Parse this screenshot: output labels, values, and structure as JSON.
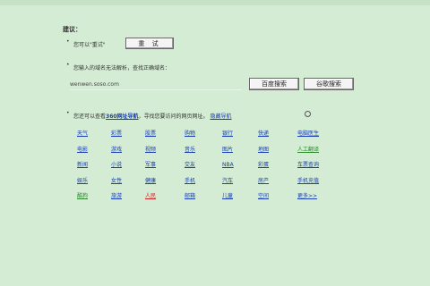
{
  "heading": "建议：",
  "retry": {
    "text": "您可以\"重试\"",
    "button_label": "重 试"
  },
  "search": {
    "text": "您输入的域名无法解析，查找正确域名：",
    "input_value": "wenwen.soso.com",
    "baidu_label": "百度搜索",
    "google_label": "谷歌搜索"
  },
  "hint": {
    "prefix": "您还可以查看",
    "nav_link": "360网址导航",
    "suffix": "，寻找您要访问的网页网址。",
    "tip_link": "隐藏导航"
  },
  "grid": [
    {
      "text": "天气",
      "color": "#1a3fb5"
    },
    {
      "text": "彩票",
      "color": "#1a3fb5"
    },
    {
      "text": "股票",
      "color": "#1a3fb5"
    },
    {
      "text": "购物",
      "color": "#1a3fb5"
    },
    {
      "text": "银行",
      "color": "#1a3fb5"
    },
    {
      "text": "快递",
      "color": "#1a3fb5"
    },
    {
      "text": "电脑医生",
      "color": "#1a3fb5"
    },
    {
      "text": "电影",
      "color": "#1a3fb5"
    },
    {
      "text": "游戏",
      "color": "#1a3fb5"
    },
    {
      "text": "视频",
      "color": "#1a3fb5"
    },
    {
      "text": "音乐",
      "color": "#1a3fb5"
    },
    {
      "text": "图片",
      "color": "#1a3fb5"
    },
    {
      "text": "地图",
      "color": "#1a3fb5"
    },
    {
      "text": "人工翻译",
      "color": "#2a8a2a"
    },
    {
      "text": "新闻",
      "color": "#1a3fb5"
    },
    {
      "text": "小说",
      "color": "#1a3fb5"
    },
    {
      "text": "军事",
      "color": "#1a3fb5"
    },
    {
      "text": "交友",
      "color": "#1a3fb5"
    },
    {
      "text": "NBA",
      "color": "#1a3fb5"
    },
    {
      "text": "彩蛋",
      "color": "#1a3fb5"
    },
    {
      "text": "车票查询",
      "color": "#1a3fb5"
    },
    {
      "text": "娱乐",
      "color": "#1a3fb5"
    },
    {
      "text": "女性",
      "color": "#1a3fb5"
    },
    {
      "text": "健康",
      "color": "#1a3fb5"
    },
    {
      "text": "手机",
      "color": "#1a3fb5"
    },
    {
      "text": "汽车",
      "color": "#1a3fb5"
    },
    {
      "text": "房产",
      "color": "#1a3fb5"
    },
    {
      "text": "手机充值",
      "color": "#1a3fb5"
    },
    {
      "text": "酷狗",
      "color": "#2a8a2a"
    },
    {
      "text": "旅游",
      "color": "#1a3fb5"
    },
    {
      "text": "人民",
      "color": "#c52020"
    },
    {
      "text": "邮箱",
      "color": "#1a3fb5"
    },
    {
      "text": "儿童",
      "color": "#1a3fb5"
    },
    {
      "text": "空间",
      "color": "#1a3fb5"
    },
    {
      "text": "更多>>",
      "color": "#1a3fb5"
    }
  ]
}
